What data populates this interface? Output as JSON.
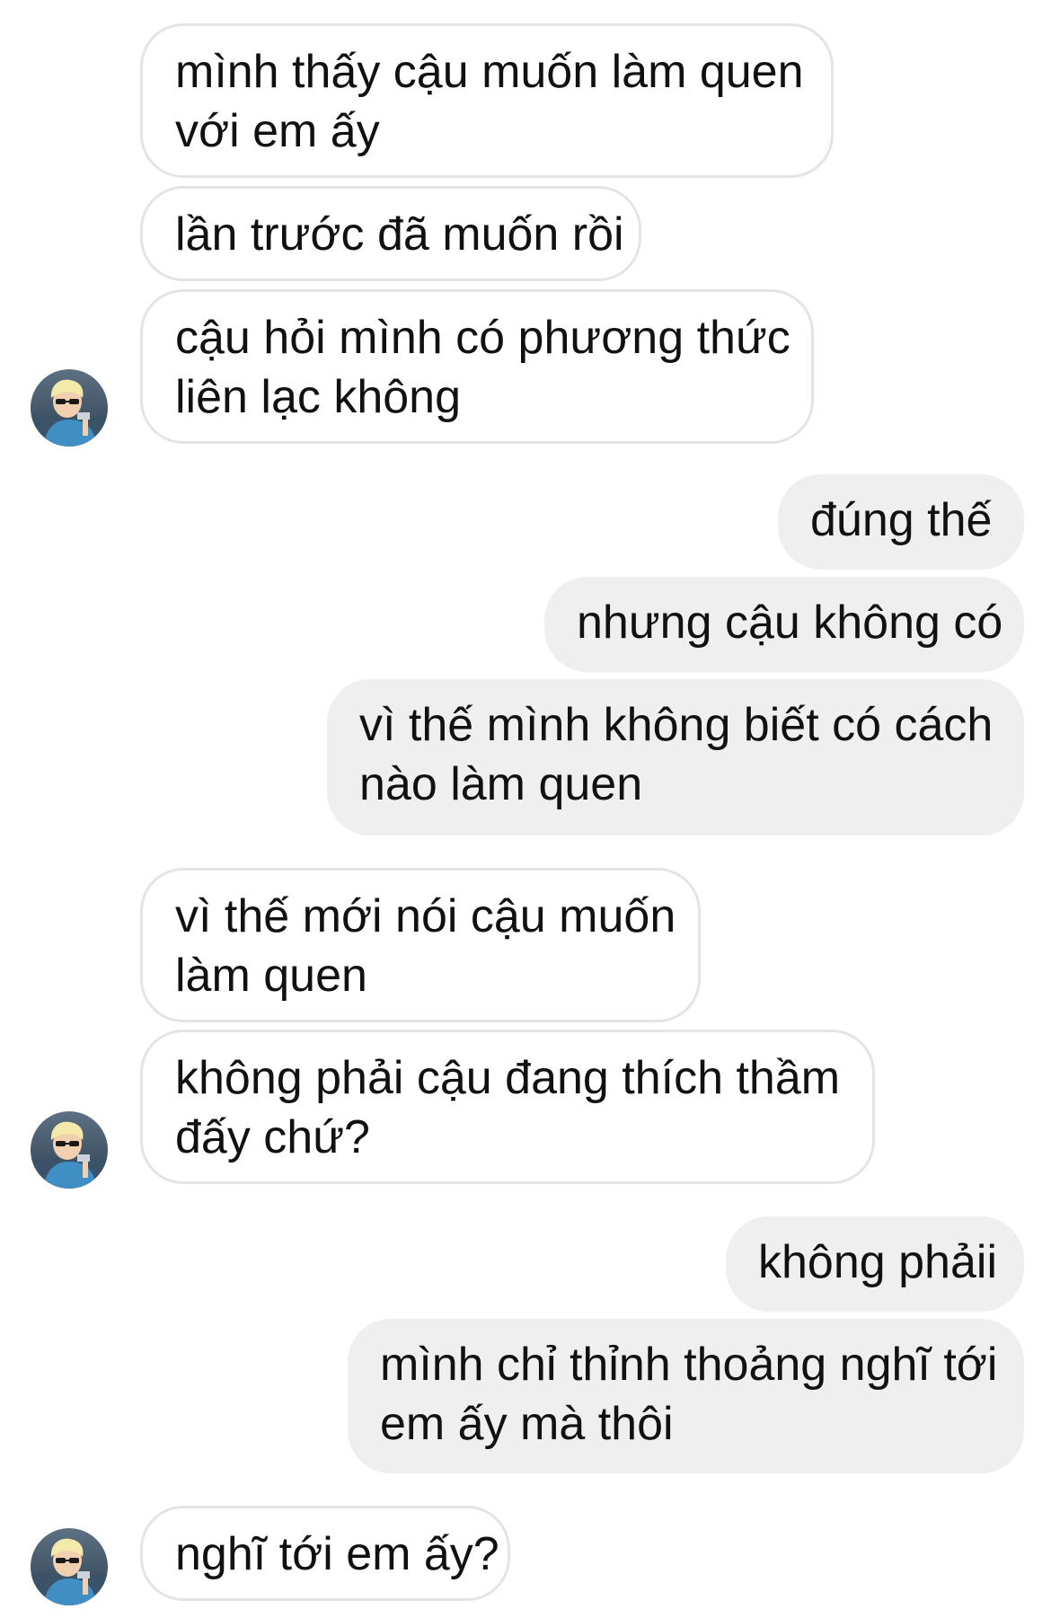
{
  "conversation": {
    "messages": [
      {
        "sender": "them",
        "lines": [
          "mình thấy cậu muốn làm quen",
          "với em ấy"
        ]
      },
      {
        "sender": "them",
        "lines": [
          "lần trước đã muốn rồi"
        ]
      },
      {
        "sender": "them",
        "lines": [
          "cậu hỏi mình có phương thức",
          "liên lạc không"
        ]
      },
      {
        "sender": "me",
        "lines": [
          "đúng thế"
        ]
      },
      {
        "sender": "me",
        "lines": [
          "nhưng cậu không có"
        ]
      },
      {
        "sender": "me",
        "lines": [
          "vì thế mình không biết có cách",
          "nào làm quen"
        ]
      },
      {
        "sender": "them",
        "lines": [
          "vì thế mới nói cậu muốn",
          "làm quen"
        ]
      },
      {
        "sender": "them",
        "lines": [
          "không phải cậu đang thích thầm",
          "đấy chứ?"
        ]
      },
      {
        "sender": "me",
        "lines": [
          "không phảii"
        ]
      },
      {
        "sender": "me",
        "lines": [
          "mình chỉ thỉnh thoảng nghĩ tới",
          "em ấy mà thôi"
        ]
      },
      {
        "sender": "them",
        "lines": [
          "nghĩ tới em ấy?"
        ]
      }
    ]
  },
  "colors": {
    "incoming_bubble_bg": "#ffffff",
    "incoming_bubble_border": "#e4e4e6",
    "outgoing_bubble_bg": "#efefef",
    "text": "#111111"
  },
  "icons": {
    "avatar": "contact-avatar-photo"
  }
}
